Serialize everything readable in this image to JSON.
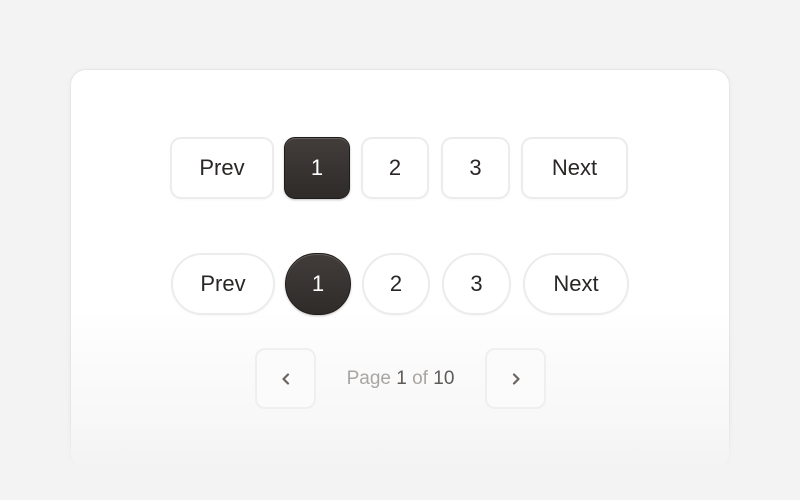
{
  "pagination_square": {
    "prev_label": "Prev",
    "pages": [
      "1",
      "2",
      "3"
    ],
    "active_page": "1",
    "next_label": "Next"
  },
  "pagination_pill": {
    "prev_label": "Prev",
    "pages": [
      "1",
      "2",
      "3"
    ],
    "active_page": "1",
    "next_label": "Next"
  },
  "pagination_compact": {
    "prev_icon": "chevron-left-icon",
    "next_icon": "chevron-right-icon",
    "page_word": "Page",
    "current_page": "1",
    "of_word": "of",
    "total_pages": "10"
  },
  "colors": {
    "active_bg": "#2f2b29",
    "active_text": "#ffffff",
    "text": "#2a2625",
    "muted_text": "#a9a5a2",
    "border": "#ececec",
    "page_bg": "#f3f3f3"
  }
}
